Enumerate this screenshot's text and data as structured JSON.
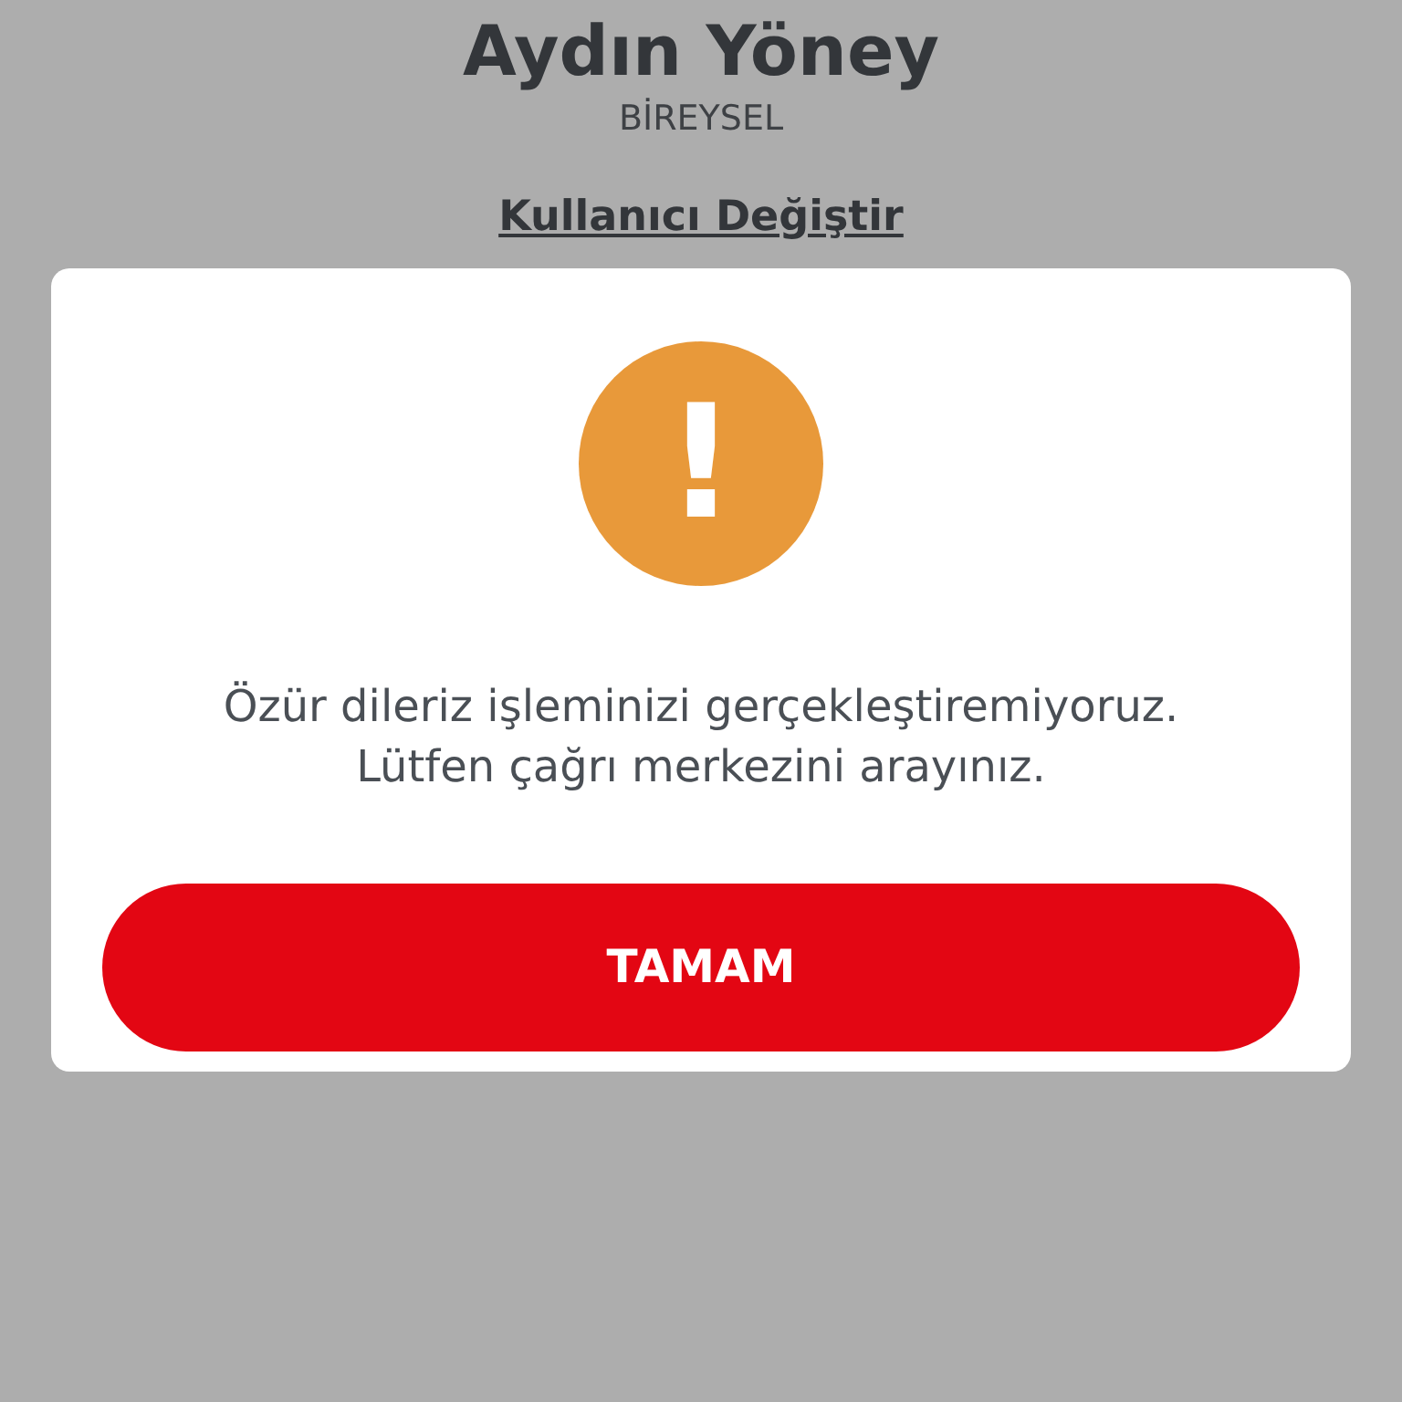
{
  "header": {
    "name": "Aydın Yöney",
    "account_type": "BİREYSEL",
    "switch_user_link": "Kullanıcı Değiştir"
  },
  "dialog": {
    "icon": "!",
    "message": "Özür dileriz işleminizi gerçekleştiremiyoruz.\nLütfen çağrı merkezini arayınız.",
    "button": "TAMAM"
  }
}
